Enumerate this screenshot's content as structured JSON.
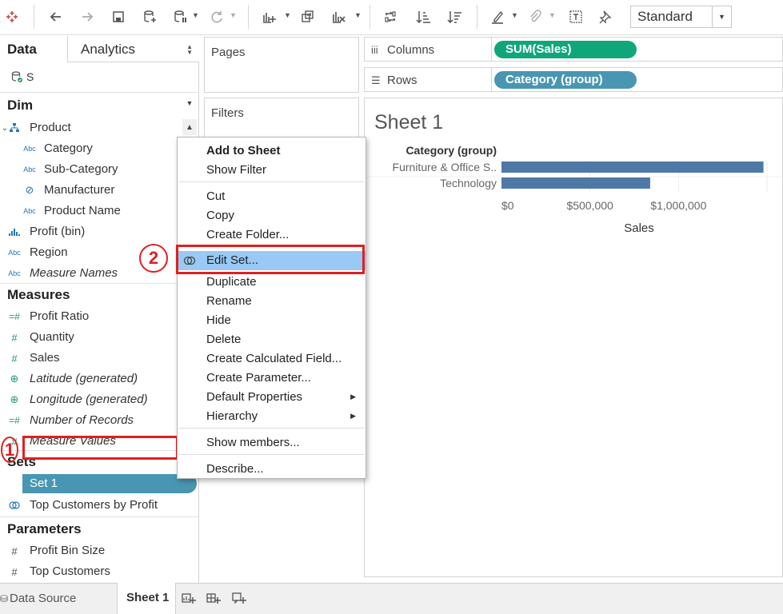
{
  "toolbar": {
    "view_mode": "Standard",
    "icons": [
      "tableau-logo-icon",
      "undo-icon",
      "redo-icon",
      "save-icon",
      "new-datasource-icon",
      "pause-update-icon",
      "refresh-icon",
      "new-worksheet-icon",
      "duplicate-sheet-icon",
      "clear-sheet-icon",
      "swap-icon",
      "sort-ascending-icon",
      "sort-descending-icon",
      "highlight-icon",
      "paperclip-icon",
      "label-icon",
      "pin-icon"
    ]
  },
  "left_panel": {
    "tab_data": "Data",
    "tab_analytics": "Analytics",
    "datasource_label": "S",
    "dimensions_header": "Dim",
    "dimensions": [
      {
        "label": "Product",
        "type": "hierarchy"
      },
      {
        "label": "Category",
        "type": "Abc"
      },
      {
        "label": "Sub-Category",
        "type": "Abc"
      },
      {
        "label": "Manufacturer",
        "type": "clip"
      },
      {
        "label": "Product Name",
        "type": "Abc"
      },
      {
        "label": "Profit (bin)",
        "type": "bin"
      },
      {
        "label": "Region",
        "type": "Abc"
      },
      {
        "label": "Measure Names",
        "type": "Abc"
      }
    ],
    "measures_header": "Measures",
    "measures": [
      {
        "label": "Profit Ratio",
        "type": "calc"
      },
      {
        "label": "Quantity",
        "type": "#"
      },
      {
        "label": "Sales",
        "type": "#"
      },
      {
        "label": "Latitude (generated)",
        "type": "geo"
      },
      {
        "label": "Longitude (generated)",
        "type": "geo"
      },
      {
        "label": "Number of Records",
        "type": "calc"
      },
      {
        "label": "Measure Values",
        "type": "#"
      }
    ],
    "sets_header": "Sets",
    "sets": [
      {
        "label": "Set 1"
      },
      {
        "label": "Top Customers by Profit"
      }
    ],
    "parameters_header": "Parameters",
    "parameters": [
      {
        "label": "Profit Bin Size"
      },
      {
        "label": "Top Customers"
      }
    ],
    "badge_1": "1"
  },
  "shelves": {
    "pages": "Pages",
    "filters": "Filters",
    "columns_label": "Columns",
    "columns_pill": "SUM(Sales)",
    "rows_label": "Rows",
    "rows_pill": "Category (group)"
  },
  "view": {
    "sheet_title": "Sheet 1"
  },
  "chart_data": {
    "type": "bar",
    "orientation": "horizontal",
    "row_header": "Category (group)",
    "categories": [
      "Furniture & Office S..",
      "Technology"
    ],
    "values": [
      1480000,
      840000
    ],
    "xlabel": "Sales",
    "xticks": [
      "$0",
      "$500,000",
      "$1,000,000"
    ],
    "xlim": [
      0,
      1500000
    ],
    "bar_color": "#4e79a7",
    "grid": true
  },
  "context_menu": {
    "items": [
      {
        "label": "Add to Sheet",
        "bold": true
      },
      {
        "label": "Show Filter"
      },
      {
        "label": "Cut"
      },
      {
        "label": "Copy"
      },
      {
        "label": "Create Folder..."
      },
      {
        "label": "Edit Set...",
        "highlighted": true
      },
      {
        "label": "Duplicate"
      },
      {
        "label": "Rename"
      },
      {
        "label": "Hide"
      },
      {
        "label": "Delete"
      },
      {
        "label": "Create Calculated Field..."
      },
      {
        "label": "Create Parameter..."
      },
      {
        "label": "Default Properties",
        "submenu": true
      },
      {
        "label": "Hierarchy",
        "submenu": true
      },
      {
        "label": "Show members..."
      },
      {
        "label": "Describe..."
      }
    ],
    "badge_2": "2"
  },
  "bottom_tabs": {
    "data_source": "Data Source",
    "sheet1": "Sheet 1"
  }
}
